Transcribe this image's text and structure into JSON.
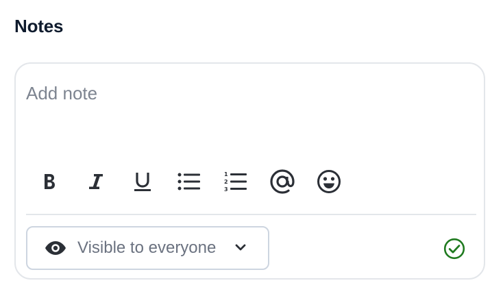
{
  "notes": {
    "title": "Notes",
    "input": {
      "placeholder": "Add note",
      "value": ""
    },
    "toolbar": [
      {
        "name": "bold-button",
        "icon": "bold-icon"
      },
      {
        "name": "italic-button",
        "icon": "italic-icon"
      },
      {
        "name": "underline-button",
        "icon": "underline-icon"
      },
      {
        "name": "bulleted-list-button",
        "icon": "bulleted-list-icon"
      },
      {
        "name": "numbered-list-button",
        "icon": "numbered-list-icon"
      },
      {
        "name": "mention-button",
        "icon": "at-sign-icon"
      },
      {
        "name": "emoji-button",
        "icon": "smiley-icon"
      }
    ],
    "visibility": {
      "selected": "Visible to everyone",
      "icon": "eye-icon"
    },
    "submit": {
      "icon": "check-circle-icon",
      "color": "#1f7a1f"
    },
    "colors": {
      "title": "#0f1b2d",
      "border": "#e3e6ea",
      "select_border": "#cdd5e0",
      "muted_text": "#6b7280",
      "icon": "#2b2f36"
    }
  }
}
